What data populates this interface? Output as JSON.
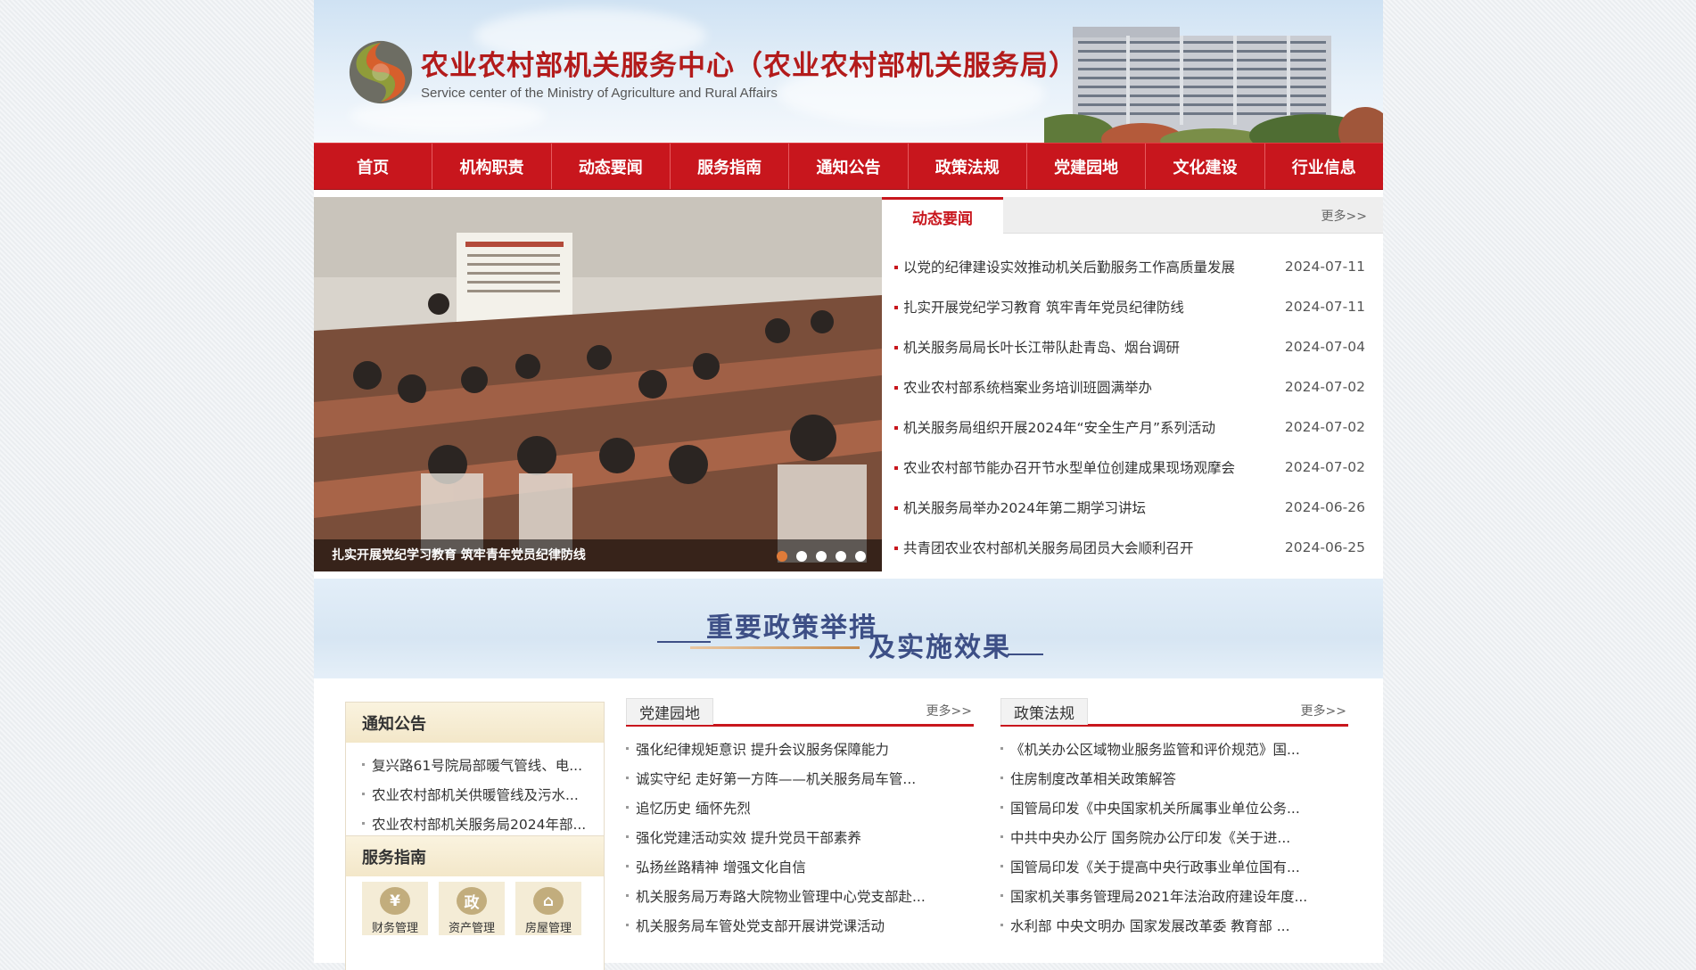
{
  "header": {
    "title": "农业农村部机关服务中心（农业农村部机关服务局）",
    "subtitle": "Service center of the Ministry of Agriculture and Rural Affairs"
  },
  "nav": [
    "首页",
    "机构职责",
    "动态要闻",
    "服务指南",
    "通知公告",
    "政策法规",
    "党建园地",
    "文化建设",
    "行业信息"
  ],
  "slider": {
    "caption": "扎实开展党纪学习教育 筑牢青年党员纪律防线",
    "slide_count": 5,
    "active_index": 0
  },
  "news": {
    "tab": "动态要闻",
    "more": "更多>>",
    "items": [
      {
        "title": "以党的纪律建设实效推动机关后勤服务工作高质量发展",
        "date": "2024-07-11"
      },
      {
        "title": "扎实开展党纪学习教育 筑牢青年党员纪律防线",
        "date": "2024-07-11"
      },
      {
        "title": "机关服务局局长叶长江带队赴青岛、烟台调研",
        "date": "2024-07-04"
      },
      {
        "title": "农业农村部系统档案业务培训班圆满举办",
        "date": "2024-07-02"
      },
      {
        "title": "机关服务局组织开展2024年“安全生产月”系列活动",
        "date": "2024-07-02"
      },
      {
        "title": "农业农村部节能办召开节水型单位创建成果现场观摩会",
        "date": "2024-07-02"
      },
      {
        "title": "机关服务局举办2024年第二期学习讲坛",
        "date": "2024-06-26"
      },
      {
        "title": "共青团农业农村部机关服务局团员大会顺利召开",
        "date": "2024-06-25"
      }
    ]
  },
  "banner": {
    "line1": "重要政策举措",
    "line2": "及实施效果"
  },
  "notice": {
    "title": "通知公告",
    "items": [
      "复兴路61号院局部暖气管线、电...",
      "农业农村部机关供暖管线及污水...",
      "农业农村部机关服务局2024年部..."
    ]
  },
  "services": {
    "title": "服务指南",
    "items": [
      {
        "icon": "yen-icon",
        "glyph": "¥",
        "label": "财务管理"
      },
      {
        "icon": "policy-icon",
        "glyph": "政",
        "label": "资产管理"
      },
      {
        "icon": "house-icon",
        "glyph": "⌂",
        "label": "房屋管理"
      }
    ]
  },
  "party": {
    "title": "党建园地",
    "more": "更多>>",
    "items": [
      "强化纪律规矩意识 提升会议服务保障能力",
      "诚实守纪 走好第一方阵——机关服务局车管...",
      "追忆历史 缅怀先烈",
      "强化党建活动实效 提升党员干部素养",
      "弘扬丝路精神 增强文化自信",
      "机关服务局万寿路大院物业管理中心党支部赴...",
      "机关服务局车管处党支部开展讲党课活动"
    ]
  },
  "policy": {
    "title": "政策法规",
    "more": "更多>>",
    "items": [
      "《机关办公区域物业服务监管和评价规范》国...",
      "住房制度改革相关政策解答",
      "国管局印发《中央国家机关所属事业单位公务...",
      "中共中央办公厅 国务院办公厅印发《关于进...",
      "国管局印发《关于提高中央行政事业单位国有...",
      "国家机关事务管理局2021年法治政府建设年度...",
      "水利部 中央文明办 国家发展改革委 教育部 ..."
    ]
  },
  "colors": {
    "primary_red": "#c8161d",
    "banner_blue": "#3d4f86",
    "active_dot": "#e07b39"
  }
}
